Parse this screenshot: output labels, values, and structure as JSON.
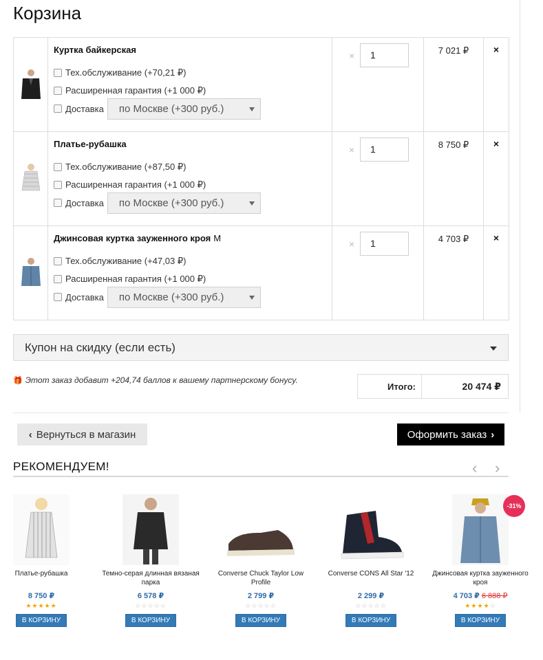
{
  "page_title": "Корзина",
  "cart": {
    "items": [
      {
        "name": "Куртка байкерская",
        "size": "",
        "service": "Тех.обслуживание (+70,21 ₽)",
        "warranty": "Расширенная гарантия (+1 000 ₽)",
        "delivery_label": "Доставка",
        "delivery_option": "по Москве (+300 руб.)",
        "qty": "1",
        "price": "7 021 ₽"
      },
      {
        "name": "Платье-рубашка",
        "size": "",
        "service": "Тех.обслуживание (+87,50 ₽)",
        "warranty": "Расширенная гарантия (+1 000 ₽)",
        "delivery_label": "Доставка",
        "delivery_option": "по Москве (+300 руб.)",
        "qty": "1",
        "price": "8 750 ₽"
      },
      {
        "name": "Джинсовая куртка зауженного кроя",
        "size": "M",
        "service": "Тех.обслуживание (+47,03 ₽)",
        "warranty": "Расширенная гарантия (+1 000 ₽)",
        "delivery_label": "Доставка",
        "delivery_option": "по Москве (+300 руб.)",
        "qty": "1",
        "price": "4 703 ₽"
      }
    ],
    "qty_multiplier": "×",
    "remove_symbol": "×"
  },
  "coupon": {
    "label": "Купон на скидку (если есть)"
  },
  "bonus": {
    "text": "Этот заказ добавит +204,74 баллов к вашему партнерскому бонусу."
  },
  "totals": {
    "label": "Итого:",
    "value": "20 474 ₽"
  },
  "actions": {
    "back_label": "Вернуться в магазин",
    "order_label": "Оформить заказ"
  },
  "recommended": {
    "title": "РЕКОМЕНДУЕМ!",
    "prev": "‹",
    "next": "›",
    "products": [
      {
        "name": "Платье-рубашка",
        "price": "8 750 ₽",
        "old_price": "",
        "rating": 5,
        "button": "В КОРЗИНУ",
        "badge": ""
      },
      {
        "name": "Темно-серая длинная вязаная парка",
        "price": "6 578 ₽",
        "old_price": "",
        "rating": 0,
        "button": "В КОРЗИНУ",
        "badge": ""
      },
      {
        "name": "Converse Chuck Taylor Low Profile",
        "price": "2 799 ₽",
        "old_price": "",
        "rating": 0,
        "button": "В КОРЗИНУ",
        "badge": ""
      },
      {
        "name": "Converse CONS All Star '12",
        "price": "2 299 ₽",
        "old_price": "",
        "rating": 0,
        "button": "В КОРЗИНУ",
        "badge": ""
      },
      {
        "name": "Джинсовая куртка зауженного кроя",
        "price": "4 703 ₽",
        "old_price": "6 888 ₽",
        "rating": 4,
        "button": "В КОРЗИНУ",
        "badge": "-31%"
      }
    ]
  },
  "colors": {
    "price_blue": "#2d6aa8",
    "cart_button": "#337ab7",
    "badge": "#e6305a",
    "star": "#f0a500"
  }
}
